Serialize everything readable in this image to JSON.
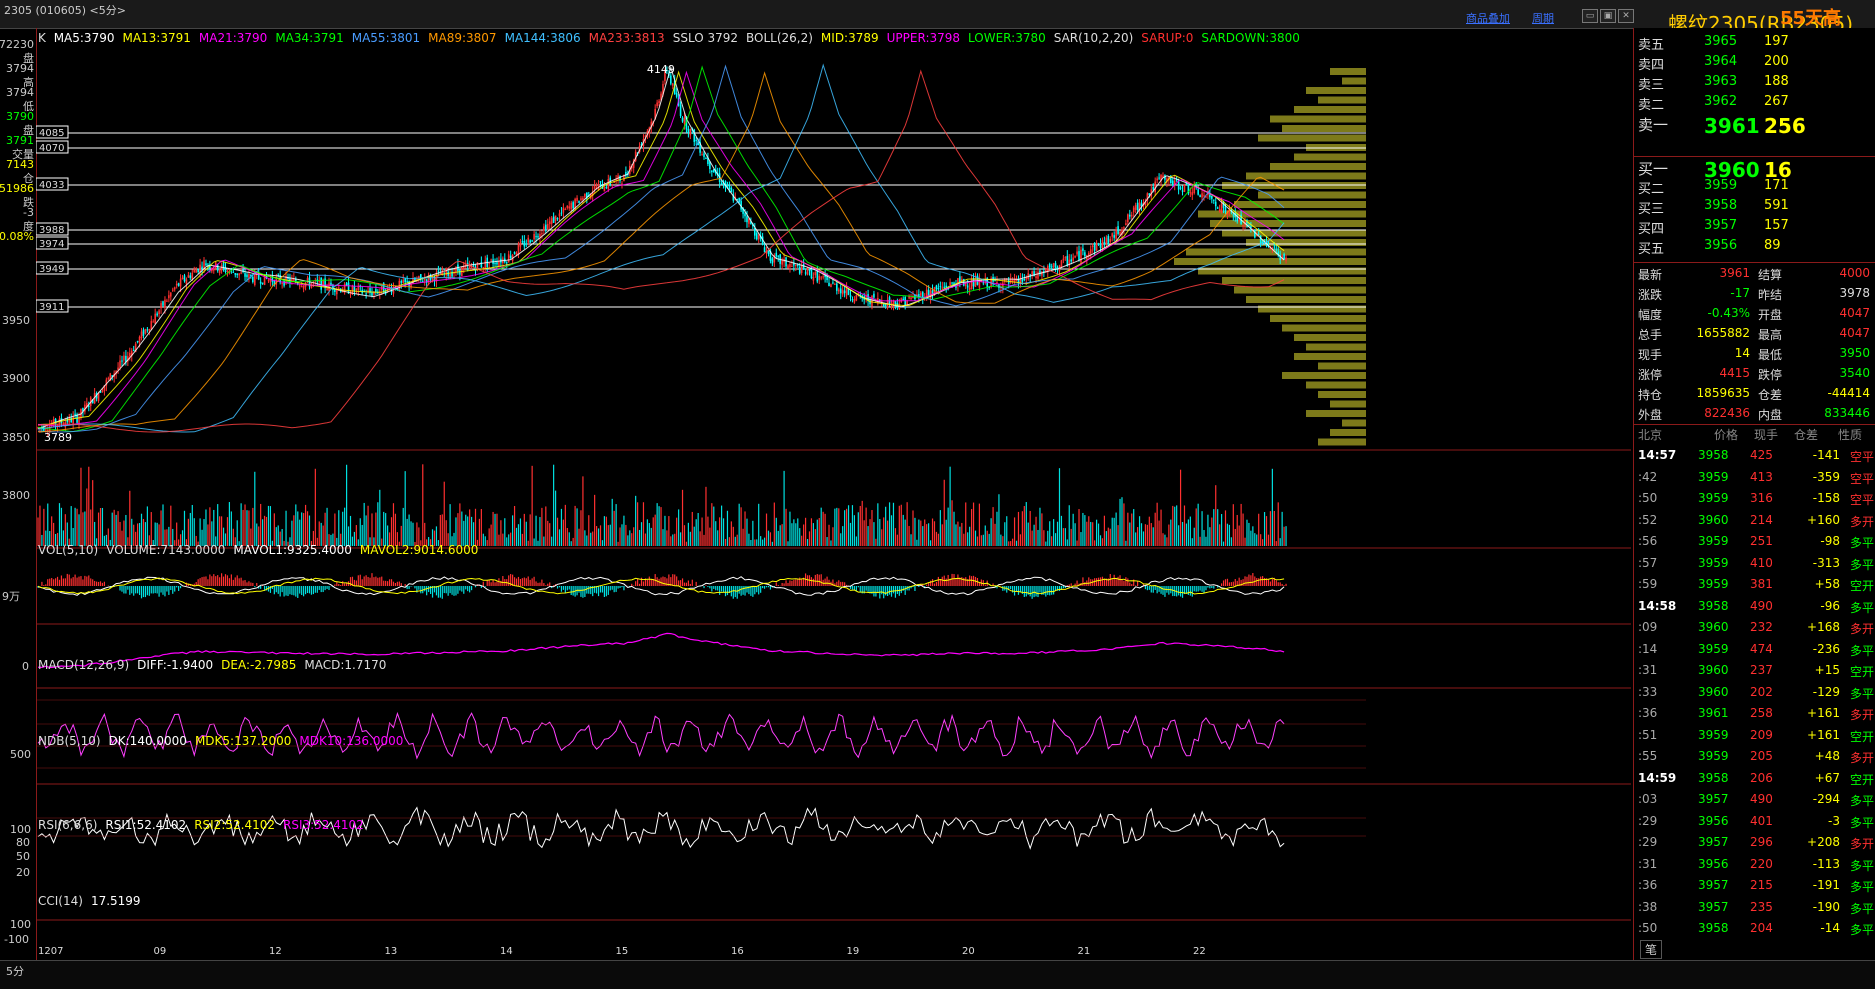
{
  "window": {
    "title": "2305 (010605) <5分>",
    "links": [
      "商品叠加",
      "周期"
    ],
    "overlay_title": "螺纹2305(RB2305)",
    "watermark": "55天高"
  },
  "yaxis": {
    "left_info": [
      "72230",
      "盘",
      "3794",
      "高",
      "3794",
      "低",
      "3790",
      "盘",
      "3791",
      "交量",
      "7143",
      "仓",
      "51986",
      "跌",
      "-3",
      "度",
      "0.08%"
    ],
    "price_ticks": [
      "3950",
      "3900",
      "3850",
      "3800"
    ]
  },
  "main_indicator": {
    "prefix": "K",
    "items": [
      {
        "text": "MA5:3790",
        "color": "#ffffff"
      },
      {
        "text": "MA13:3791",
        "color": "#ffff00"
      },
      {
        "text": "MA21:3790",
        "color": "#ff00ff"
      },
      {
        "text": "MA34:3791",
        "color": "#00ff00"
      },
      {
        "text": "MA55:3801",
        "color": "#4a9dff"
      },
      {
        "text": "MA89:3807",
        "color": "#ff9900"
      },
      {
        "text": "MA144:3806",
        "color": "#40c0ff"
      },
      {
        "text": "MA233:3813",
        "color": "#ff4040"
      },
      {
        "text": "SSLO 3792",
        "color": "#dddddd"
      },
      {
        "text": "BOLL(26,2)",
        "color": "#dddddd"
      },
      {
        "text": "MID:3789",
        "color": "#ffff00"
      },
      {
        "text": "UPPER:3798",
        "color": "#ff00ff"
      },
      {
        "text": "LOWER:3780",
        "color": "#00ff00"
      },
      {
        "text": "SAR(10,2,20)",
        "color": "#dddddd"
      },
      {
        "text": "SARUP:0",
        "color": "#ff3030"
      },
      {
        "text": "SARDOWN:3800",
        "color": "#00ff00"
      }
    ]
  },
  "price_levels": [
    "4085",
    "4070",
    "4033",
    "3988",
    "3974",
    "3949",
    "3911"
  ],
  "annotations": {
    "high": "4149",
    "low": "3789"
  },
  "vol_indicator": {
    "items": [
      {
        "text": "VOL(5,10)",
        "color": "#dddddd"
      },
      {
        "text": "VOLUME:7143.0000",
        "color": "#dddddd"
      },
      {
        "text": "MAVOL1:9325.4000",
        "color": "#ffffff"
      },
      {
        "text": "MAVOL2:9014.6000",
        "color": "#ffff00"
      }
    ],
    "tick": "9万"
  },
  "macd_indicator": {
    "items": [
      {
        "text": "MACD(12,26,9)",
        "color": "#dddddd"
      },
      {
        "text": "DIFF:-1.9400",
        "color": "#ffffff"
      },
      {
        "text": "DEA:-2.7985",
        "color": "#ffff00"
      },
      {
        "text": "MACD:1.7170",
        "color": "#dddddd"
      }
    ],
    "tick": "0"
  },
  "ndb_indicator": {
    "items": [
      {
        "text": "NDB(5,10)",
        "color": "#dddddd"
      },
      {
        "text": "DK:140.0000",
        "color": "#ffffff"
      },
      {
        "text": "MDK5:137.2000",
        "color": "#ffff00"
      },
      {
        "text": "MDK10:136.0000",
        "color": "#ff00ff"
      }
    ],
    "tick": "500"
  },
  "rsi_indicator": {
    "items": [
      {
        "text": "RSI(6,6,6)",
        "color": "#dddddd"
      },
      {
        "text": "RSI1:52.4102",
        "color": "#ffffff"
      },
      {
        "text": "RSI2:52.4102",
        "color": "#ffff00"
      },
      {
        "text": "RSI3:52.4102",
        "color": "#ff00ff"
      }
    ],
    "ticks": [
      "100",
      "80",
      "50",
      "20"
    ]
  },
  "cci_indicator": {
    "items": [
      {
        "text": "CCI(14)",
        "color": "#dddddd"
      },
      {
        "text": "17.5199",
        "color": "#ffffff"
      }
    ],
    "ticks": [
      "100",
      "-100"
    ]
  },
  "xaxis": {
    "period": "5分",
    "labels": [
      "1207",
      "09",
      "12",
      "13",
      "14",
      "15",
      "16",
      "19",
      "20",
      "21",
      "22"
    ]
  },
  "orderbook": {
    "asks": [
      {
        "label": "卖五",
        "price": "3965",
        "vol": "197"
      },
      {
        "label": "卖四",
        "price": "3964",
        "vol": "200"
      },
      {
        "label": "卖三",
        "price": "3963",
        "vol": "188"
      },
      {
        "label": "卖二",
        "price": "3962",
        "vol": "267"
      },
      {
        "label": "卖一",
        "price": "3961",
        "vol": "256"
      }
    ],
    "bids": [
      {
        "label": "买一",
        "price": "3960",
        "vol": "16"
      },
      {
        "label": "买二",
        "price": "3959",
        "vol": "171"
      },
      {
        "label": "买三",
        "price": "3958",
        "vol": "591"
      },
      {
        "label": "买四",
        "price": "3957",
        "vol": "157"
      },
      {
        "label": "买五",
        "price": "3956",
        "vol": "89"
      }
    ]
  },
  "stats": [
    {
      "l1": "最新",
      "v1": "3961",
      "c1": "#ff3030",
      "l2": "结算",
      "v2": "4000",
      "c2": "#ff3030"
    },
    {
      "l1": "涨跌",
      "v1": "-17",
      "c1": "#00ff00",
      "l2": "昨结",
      "v2": "3978",
      "c2": "#dddddd"
    },
    {
      "l1": "幅度",
      "v1": "-0.43%",
      "c1": "#00ff00",
      "l2": "开盘",
      "v2": "4047",
      "c2": "#ff3030"
    },
    {
      "l1": "总手",
      "v1": "1655882",
      "c1": "#ffff00",
      "l2": "最高",
      "v2": "4047",
      "c2": "#ff3030"
    },
    {
      "l1": "现手",
      "v1": "14",
      "c1": "#ffff00",
      "l2": "最低",
      "v2": "3950",
      "c2": "#00ff00"
    },
    {
      "l1": "涨停",
      "v1": "4415",
      "c1": "#ff3030",
      "l2": "跌停",
      "v2": "3540",
      "c2": "#00ff00"
    },
    {
      "l1": "持仓",
      "v1": "1859635",
      "c1": "#ffff00",
      "l2": "仓差",
      "v2": "-44414",
      "c2": "#ffff00"
    },
    {
      "l1": "外盘",
      "v1": "822436",
      "c1": "#ff3030",
      "l2": "内盘",
      "v2": "833446",
      "c2": "#00ff00"
    }
  ],
  "trades_header": [
    "北京",
    "价格",
    "现手",
    "仓差",
    "性质"
  ],
  "trades": [
    {
      "t": "14:57",
      "p": "3958",
      "v": "425",
      "d": "-141",
      "k": "空平"
    },
    {
      "t": ":42",
      "p": "3959",
      "v": "413",
      "d": "-359",
      "k": "空平"
    },
    {
      "t": ":50",
      "p": "3959",
      "v": "316",
      "d": "-158",
      "k": "空平"
    },
    {
      "t": ":52",
      "p": "3960",
      "v": "214",
      "d": "+160",
      "k": "多开"
    },
    {
      "t": ":56",
      "p": "3959",
      "v": "251",
      "d": "-98",
      "k": "多平"
    },
    {
      "t": ":57",
      "p": "3959",
      "v": "410",
      "d": "-313",
      "k": "多平"
    },
    {
      "t": ":59",
      "p": "3959",
      "v": "381",
      "d": "+58",
      "k": "空开"
    },
    {
      "t": "14:58",
      "p": "3958",
      "v": "490",
      "d": "-96",
      "k": "多平"
    },
    {
      "t": ":09",
      "p": "3960",
      "v": "232",
      "d": "+168",
      "k": "多开"
    },
    {
      "t": ":14",
      "p": "3959",
      "v": "474",
      "d": "-236",
      "k": "多平"
    },
    {
      "t": ":31",
      "p": "3960",
      "v": "237",
      "d": "+15",
      "k": "空开"
    },
    {
      "t": ":33",
      "p": "3960",
      "v": "202",
      "d": "-129",
      "k": "多平"
    },
    {
      "t": ":36",
      "p": "3961",
      "v": "258",
      "d": "+161",
      "k": "多开"
    },
    {
      "t": ":51",
      "p": "3959",
      "v": "209",
      "d": "+161",
      "k": "空开"
    },
    {
      "t": ":55",
      "p": "3959",
      "v": "205",
      "d": "+48",
      "k": "多开"
    },
    {
      "t": "14:59",
      "p": "3958",
      "v": "206",
      "d": "+67",
      "k": "空开"
    },
    {
      "t": ":03",
      "p": "3957",
      "v": "490",
      "d": "-294",
      "k": "多平"
    },
    {
      "t": ":29",
      "p": "3956",
      "v": "401",
      "d": "-3",
      "k": "多平"
    },
    {
      "t": ":29",
      "p": "3957",
      "v": "296",
      "d": "+208",
      "k": "多开"
    },
    {
      "t": ":31",
      "p": "3956",
      "v": "220",
      "d": "-113",
      "k": "多平"
    },
    {
      "t": ":36",
      "p": "3957",
      "v": "215",
      "d": "-191",
      "k": "多平"
    },
    {
      "t": ":38",
      "p": "3957",
      "v": "235",
      "d": "-190",
      "k": "多平"
    },
    {
      "t": ":50",
      "p": "3958",
      "v": "204",
      "d": "-14",
      "k": "多平"
    }
  ],
  "bottom_tab": "笔",
  "volume_profile": [
    3,
    2,
    5,
    4,
    6,
    8,
    7,
    9,
    5,
    6,
    8,
    10,
    12,
    9,
    11,
    14,
    13,
    12,
    10,
    15,
    16,
    14,
    12,
    11,
    10,
    9,
    8,
    7,
    6,
    5,
    6,
    4,
    7,
    5,
    4,
    3,
    5,
    2,
    3,
    4
  ],
  "colors": {
    "up": "#ff3030",
    "down": "#00ffff",
    "grid": "#8b1a1a",
    "profile": "#7d7a1a"
  }
}
